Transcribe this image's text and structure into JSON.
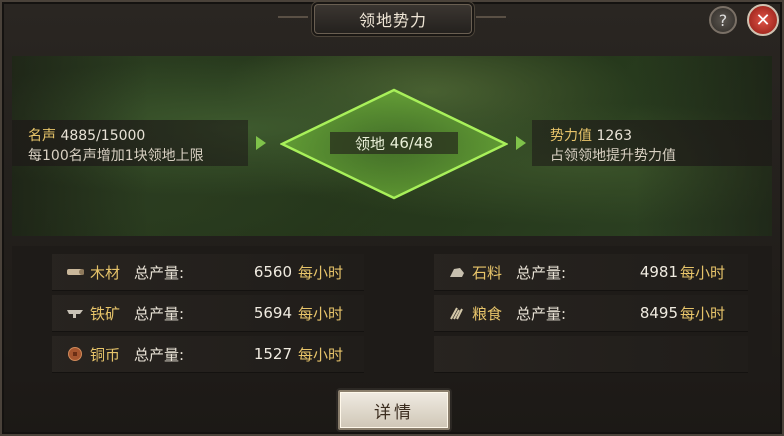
{
  "window": {
    "title": "领地势力",
    "help_label": "?",
    "close_label": "✕"
  },
  "prestige": {
    "label": "名声",
    "value": "4885/15000",
    "note": "每100名声增加1块领地上限"
  },
  "territory": {
    "label": "领地",
    "value": "46/48"
  },
  "power": {
    "label": "势力值",
    "value": "1263",
    "note": "占领领地提升势力值"
  },
  "resources": [
    {
      "icon": "wood-icon",
      "name": "木材",
      "label": "总产量:",
      "value": "6560",
      "unit": "每小时"
    },
    {
      "icon": "stone-icon",
      "name": "石料",
      "label": "总产量:",
      "value": "4981",
      "unit": "每小时"
    },
    {
      "icon": "iron-icon",
      "name": "铁矿",
      "label": "总产量:",
      "value": "5694",
      "unit": "每小时"
    },
    {
      "icon": "grain-icon",
      "name": "粮食",
      "label": "总产量:",
      "value": "8495",
      "unit": "每小时"
    },
    {
      "icon": "copper-coin-icon",
      "name": "铜币",
      "label": "总产量:",
      "value": "1527",
      "unit": "每小时"
    }
  ],
  "detail_button": "详情",
  "colors": {
    "accent_gold": "#e7c46a",
    "territory_green": "#7fc24a",
    "close_red": "#c8342a"
  }
}
